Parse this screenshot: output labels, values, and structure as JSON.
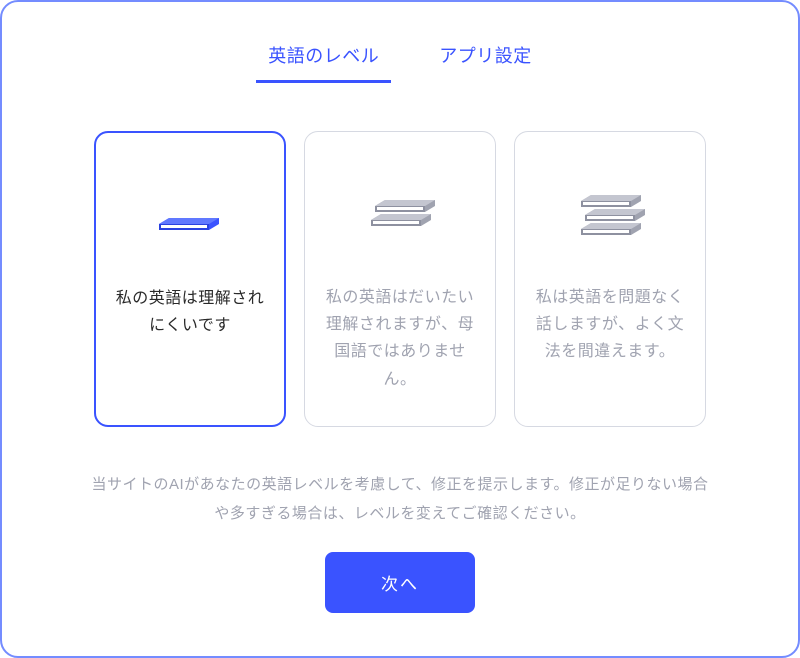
{
  "tabs": {
    "level": "英語のレベル",
    "settings": "アプリ設定"
  },
  "cards": [
    {
      "text": "私の英語は理解されにくいです",
      "selected": true
    },
    {
      "text": "私の英語はだいたい理解されますが、母国語ではありません。",
      "selected": false
    },
    {
      "text": "私は英語を問題なく話しますが、よく文法を間違えます。",
      "selected": false
    }
  ],
  "description": "当サイトのAIがあなたの英語レベルを考慮して、修正を提示します。修正が足りない場合や多すぎる場合は、レベルを変えてご確認ください。",
  "nextButton": "次へ",
  "colors": {
    "primary": "#3a53ff",
    "gray": "#a0a3b0"
  }
}
